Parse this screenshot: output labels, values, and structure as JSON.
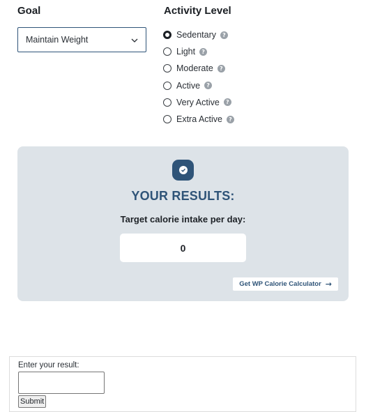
{
  "goal": {
    "title": "Goal",
    "selected": "Maintain Weight"
  },
  "activity": {
    "title": "Activity Level",
    "options": [
      {
        "label": "Sedentary",
        "checked": true
      },
      {
        "label": "Light",
        "checked": false
      },
      {
        "label": "Moderate",
        "checked": false
      },
      {
        "label": "Active",
        "checked": false
      },
      {
        "label": "Very Active",
        "checked": false
      },
      {
        "label": "Extra Active",
        "checked": false
      }
    ],
    "help_glyph": "?"
  },
  "results": {
    "title": "YOUR RESULTS:",
    "label": "Target calorie intake per day:",
    "value": "0",
    "link_label": "Get WP Calorie Calculator",
    "link_arrow": "→",
    "icon": "check-badge-icon"
  },
  "form": {
    "label": "Enter your result:",
    "submit_label": "Submit"
  },
  "colors": {
    "accent": "#2f5478",
    "card_bg": "#dde3e8"
  }
}
